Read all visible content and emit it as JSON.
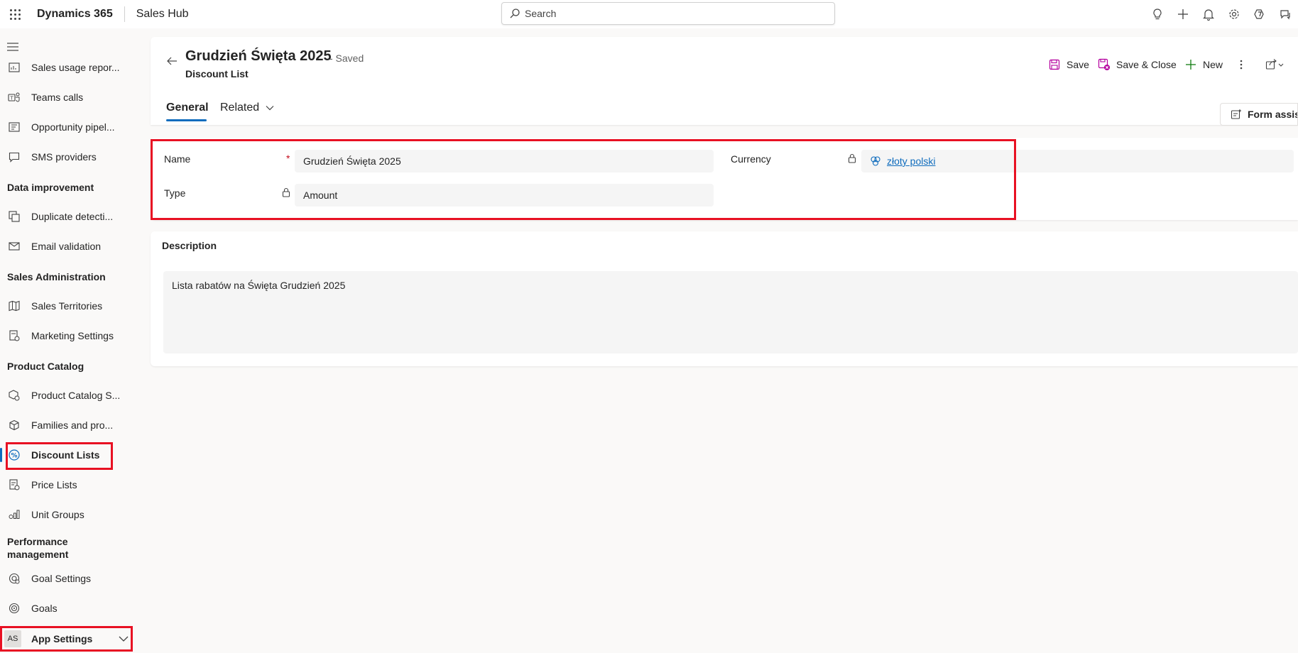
{
  "topbar": {
    "brand": "Dynamics 365",
    "app_name": "Sales Hub",
    "search_placeholder": "Search"
  },
  "sidebar": {
    "items": [
      {
        "label": "Sales usage repor...",
        "icon": "report-icon"
      },
      {
        "label": "Teams calls",
        "icon": "teams-icon"
      },
      {
        "label": "Opportunity pipel...",
        "icon": "pipeline-icon"
      },
      {
        "label": "SMS providers",
        "icon": "chat-icon"
      }
    ],
    "groups": {
      "data_improvement": {
        "title": "Data improvement",
        "items": [
          {
            "label": "Duplicate detecti...",
            "icon": "duplicate-icon"
          },
          {
            "label": "Email validation",
            "icon": "mail-check-icon"
          }
        ]
      },
      "sales_admin": {
        "title": "Sales Administration",
        "items": [
          {
            "label": "Sales Territories",
            "icon": "map-icon"
          },
          {
            "label": "Marketing Settings",
            "icon": "marketing-icon"
          }
        ]
      },
      "product_catalog": {
        "title": "Product Catalog",
        "items": [
          {
            "label": "Product Catalog S...",
            "icon": "catalog-settings-icon"
          },
          {
            "label": "Families and pro...",
            "icon": "box-icon"
          },
          {
            "label": "Discount Lists",
            "icon": "discount-icon"
          },
          {
            "label": "Price Lists",
            "icon": "price-list-icon"
          },
          {
            "label": "Unit Groups",
            "icon": "unit-groups-icon"
          }
        ]
      },
      "performance": {
        "title": "Performance management",
        "items": [
          {
            "label": "Goal Settings",
            "icon": "goal-settings-icon"
          },
          {
            "label": "Goals",
            "icon": "target-icon"
          }
        ]
      }
    },
    "app_switcher": {
      "badge": "AS",
      "label": "App Settings"
    }
  },
  "record": {
    "title": "Grudzień Święta 2025",
    "saved_status": "- Saved",
    "entity": "Discount List",
    "tabs": [
      {
        "label": "General"
      },
      {
        "label": "Related"
      }
    ]
  },
  "commands": {
    "save": "Save",
    "save_close": "Save & Close",
    "new": "New"
  },
  "form_assist": "Form assist",
  "fields": {
    "name_label": "Name",
    "name_required": "*",
    "name_value": "Grudzień Święta 2025",
    "type_label": "Type",
    "type_value": "Amount",
    "currency_label": "Currency",
    "currency_value": "złoty polski"
  },
  "description": {
    "title": "Description",
    "value": "Lista rabatów na Święta Grudzień 2025"
  },
  "colors": {
    "accent": "#0f6cbd",
    "highlight": "#e81123",
    "required": "#c50f1f",
    "save_icon": "#b4009e"
  }
}
